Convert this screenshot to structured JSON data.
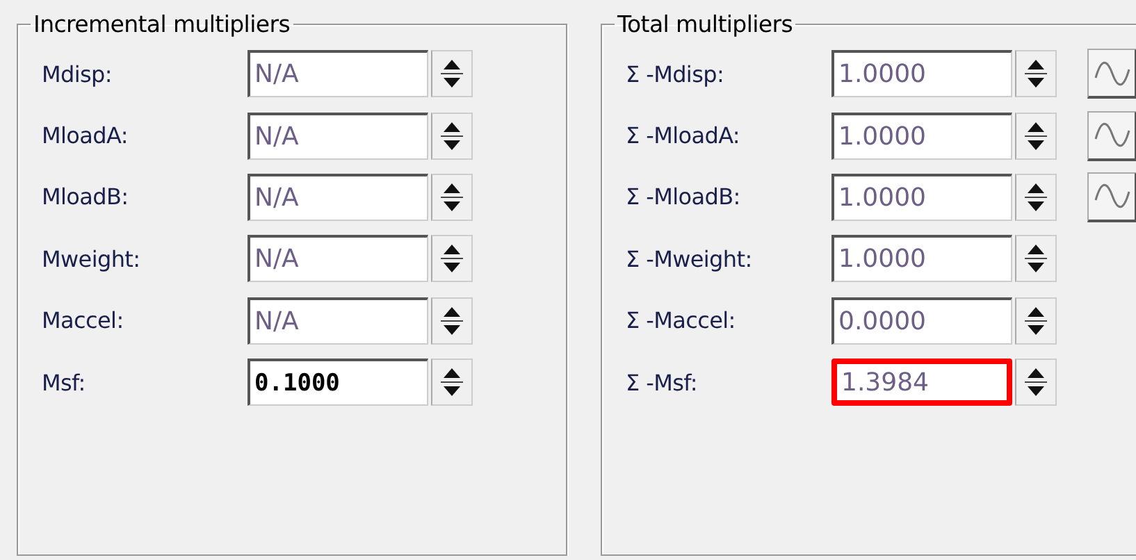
{
  "groups": [
    {
      "title": "Incremental multipliers",
      "rows": [
        {
          "label": "Mdisp:",
          "value": "N/A",
          "disabled": true,
          "highlighted": false,
          "wave_button": false
        },
        {
          "label": "MloadA:",
          "value": "N/A",
          "disabled": true,
          "highlighted": false,
          "wave_button": false
        },
        {
          "label": "MloadB:",
          "value": "N/A",
          "disabled": true,
          "highlighted": false,
          "wave_button": false
        },
        {
          "label": "Mweight:",
          "value": "N/A",
          "disabled": true,
          "highlighted": false,
          "wave_button": false
        },
        {
          "label": "Maccel:",
          "value": "N/A",
          "disabled": true,
          "highlighted": false,
          "wave_button": false
        },
        {
          "label": "Msf:",
          "value": "0.1000",
          "disabled": false,
          "highlighted": false,
          "wave_button": false
        }
      ]
    },
    {
      "title": "Total multipliers",
      "rows": [
        {
          "label": "Σ -Mdisp:",
          "value": "1.0000",
          "disabled": true,
          "highlighted": false,
          "wave_button": true
        },
        {
          "label": "Σ -MloadA:",
          "value": "1.0000",
          "disabled": true,
          "highlighted": false,
          "wave_button": true
        },
        {
          "label": "Σ -MloadB:",
          "value": "1.0000",
          "disabled": true,
          "highlighted": false,
          "wave_button": true
        },
        {
          "label": "Σ -Mweight:",
          "value": "1.0000",
          "disabled": true,
          "highlighted": false,
          "wave_button": false
        },
        {
          "label": "Σ -Maccel:",
          "value": "0.0000",
          "disabled": true,
          "highlighted": false,
          "wave_button": false
        },
        {
          "label": "Σ -Msf:",
          "value": "1.3984",
          "disabled": true,
          "highlighted": true,
          "wave_button": false
        }
      ]
    }
  ]
}
